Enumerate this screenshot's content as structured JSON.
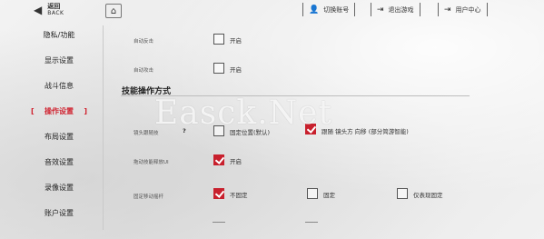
{
  "header": {
    "back_label_cn": "返回",
    "back_label_en": "BACK",
    "buttons": [
      {
        "label": "切换账号",
        "icon": "switch-account-icon"
      },
      {
        "label": "退出游戏",
        "icon": "exit-icon"
      },
      {
        "label": "用户中心",
        "icon": "user-center-icon"
      }
    ]
  },
  "sidebar": {
    "items": [
      {
        "label": "隐私/功能"
      },
      {
        "label": "显示设置"
      },
      {
        "label": "战斗信息"
      },
      {
        "label": "操作设置",
        "active": true
      },
      {
        "label": "布局设置"
      },
      {
        "label": "音效设置"
      },
      {
        "label": "录像设置"
      },
      {
        "label": "账户设置"
      }
    ]
  },
  "settings": {
    "row1": {
      "label": "自动反击",
      "option": "开启",
      "checked": false
    },
    "row2": {
      "label": "自动攻击",
      "option": "开启",
      "checked": false
    },
    "section_title": "技能操作方式",
    "row3": {
      "label": "镜头跟随技",
      "help": "?",
      "options": [
        {
          "label": "固定位置(默认)",
          "checked": false
        },
        {
          "label": "跟随 镜头方 向移 (部分简游智能)",
          "checked": true
        }
      ]
    },
    "row4": {
      "label": "拖动技能释放UI",
      "option": "开启",
      "checked": true
    },
    "row5": {
      "label": "固定移动摇杆",
      "options": [
        {
          "label": "不固定",
          "checked": true
        },
        {
          "label": "固定",
          "checked": false
        },
        {
          "label": "仅表现固定",
          "checked": false
        }
      ]
    }
  },
  "watermark": "Easck.Net",
  "colors": {
    "accent": "#c8202d",
    "active_text": "#d0222f"
  }
}
